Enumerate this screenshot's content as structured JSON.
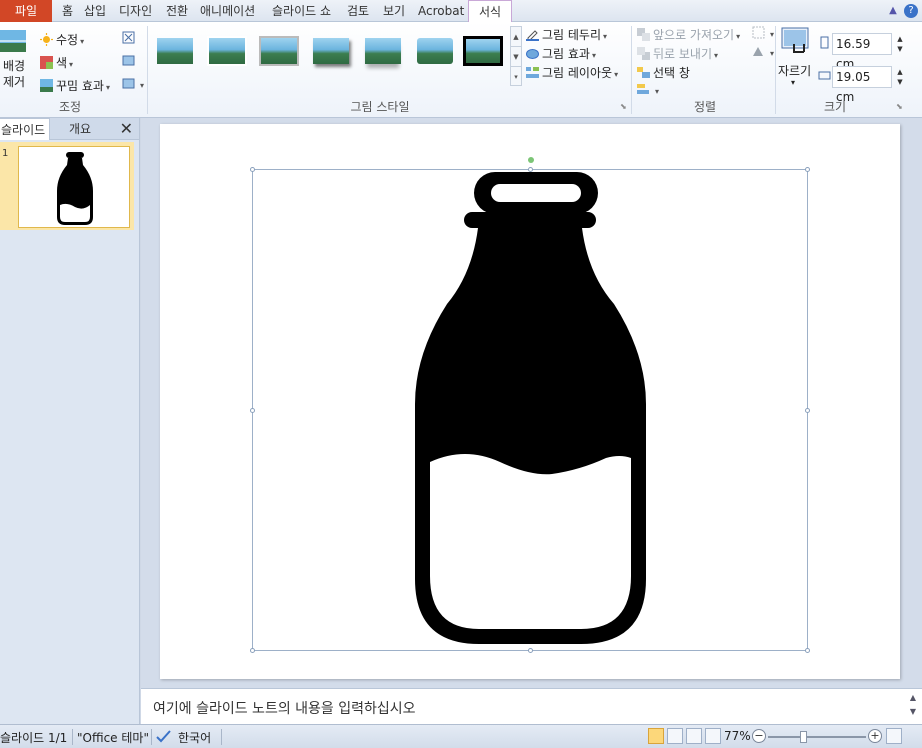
{
  "tabs": {
    "file": "파일",
    "items": [
      "홈",
      "삽입",
      "디자인",
      "전환",
      "애니메이션",
      "슬라이드 쇼",
      "검토",
      "보기",
      "Acrobat"
    ],
    "active": "서식"
  },
  "ribbon": {
    "adjust": {
      "remove_bg": [
        "배경",
        "제거"
      ],
      "corrections": "수정",
      "color": "색",
      "artistic": "꾸밈 효과",
      "label": "조정"
    },
    "styles": {
      "label": "그림 스타일",
      "border": "그림 테두리",
      "effects": "그림 효과",
      "layout": "그림 레이아웃"
    },
    "arrange": {
      "label": "정렬",
      "bring_forward": "앞으로 가져오기",
      "send_backward": "뒤로 보내기",
      "selection_pane": "선택 창"
    },
    "size": {
      "label": "크기",
      "crop": "자르기",
      "height": "16.59 cm",
      "width": "19.05 cm"
    }
  },
  "left_pane": {
    "tab_slides": "슬라이드",
    "tab_outline": "개요",
    "slide_number": "1"
  },
  "notes": {
    "placeholder": "여기에 슬라이드 노트의 내용을 입력하십시오"
  },
  "status": {
    "slide": "슬라이드 1/1",
    "theme": "\"Office 테마\"",
    "language": "한국어",
    "zoom": "77%"
  },
  "colors": {
    "file_tab": "#d24726",
    "bottle": "#000000",
    "selection": "#9db0c8",
    "rotate_handle": "#7cc576"
  }
}
